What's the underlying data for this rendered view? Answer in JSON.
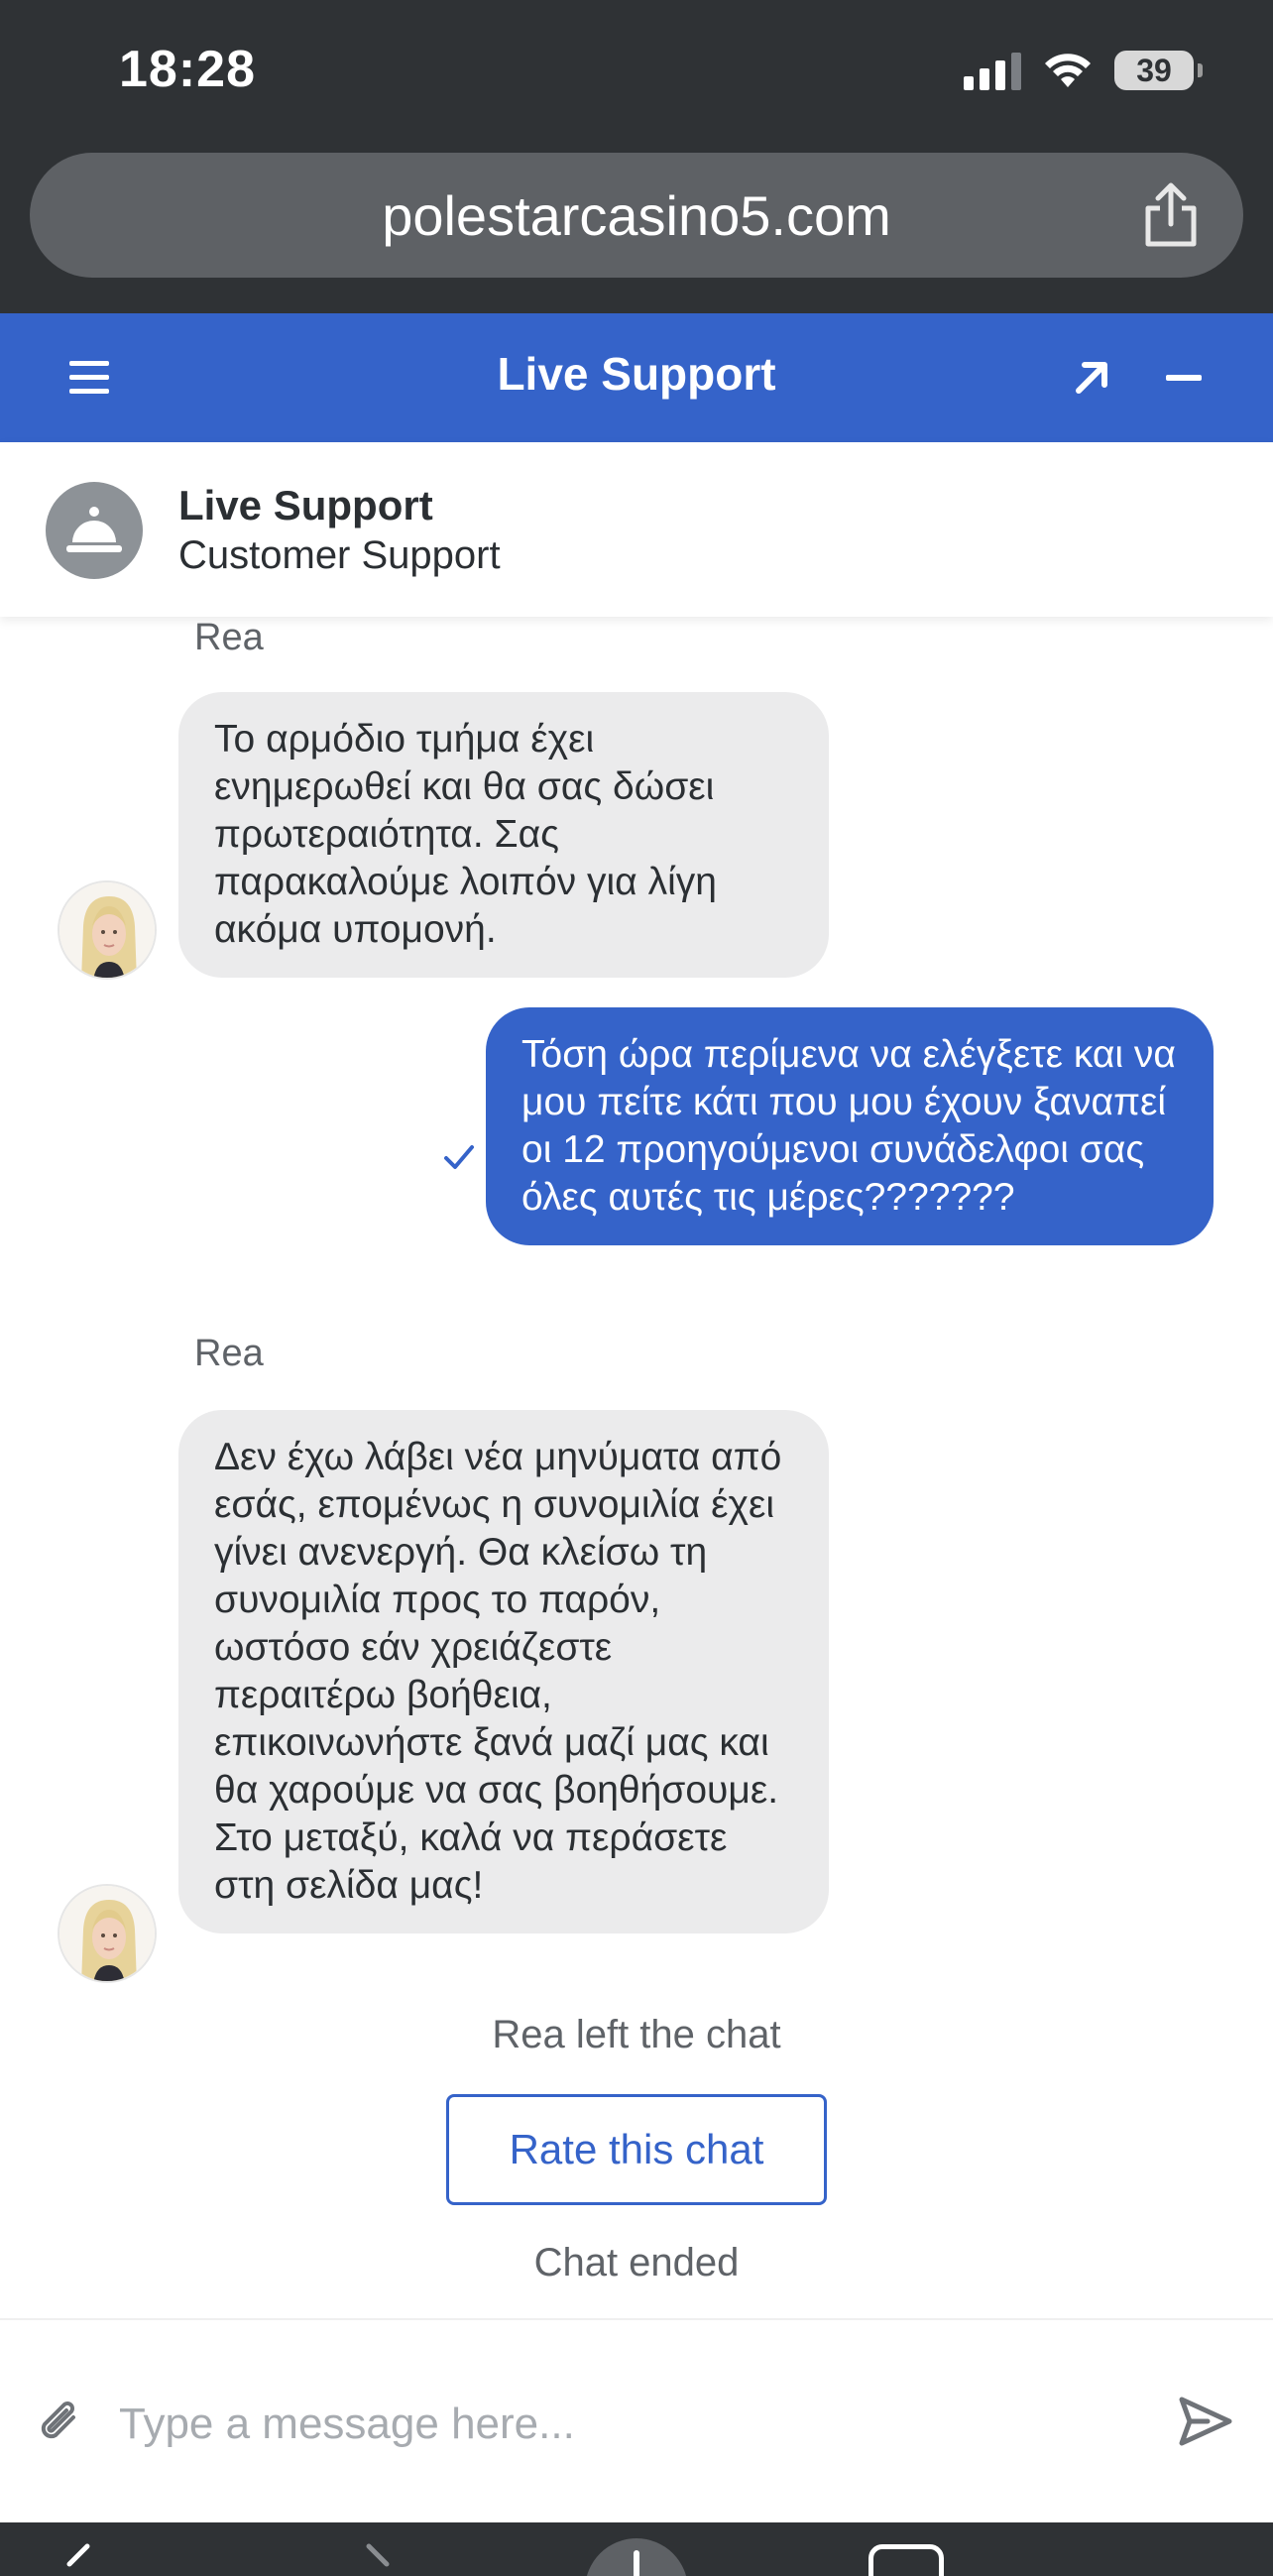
{
  "status_bar": {
    "time": "18:28",
    "battery": "39"
  },
  "browser": {
    "url": "polestarcasino5.com"
  },
  "header": {
    "title": "Live Support"
  },
  "agent": {
    "name": "Live Support",
    "role": "Customer Support"
  },
  "messages": [
    {
      "sender": "Rea",
      "direction": "in",
      "text": "Το αρμόδιο τμήμα έχει ενημερωθεί και θα σας δώσει πρωτεραιότητα. Σας παρακαλούμε λοιπόν για λίγη ακόμα υπομονή."
    },
    {
      "direction": "out",
      "text": "Τόση ώρα περίμενα να ελέγξετε και να μου πείτε κάτι που μου έχουν ξαναπεί οι 12 προηγούμενοι συνάδελφοι σας όλες αυτές τις μέρες???????"
    },
    {
      "sender": "Rea",
      "direction": "in",
      "text": "Δεν έχω λάβει νέα μηνύματα από εσάς, επομένως η συνομιλία έχει γίνει ανενεργή. Θα κλείσω τη συνομιλία προς το παρόν, ωστόσο εάν χρειάζεστε περαιτέρω βοήθεια, επικοινωνήστε ξανά μαζί μας και θα χαρούμε να σας βοηθήσουμε. Στο μεταξύ, καλά να περάσετε στη σελίδα μας!"
    }
  ],
  "system": {
    "left_chat": "Rea left the chat",
    "rate_button": "Rate this chat",
    "chat_ended": "Chat ended"
  },
  "composer": {
    "placeholder": "Type a message here..."
  },
  "colors": {
    "accent": "#3563c9",
    "chrome": "#2f3235",
    "bubble_in": "#ebebec"
  },
  "icons": [
    "menu-icon",
    "expand-icon",
    "minimize-icon",
    "bell-icon",
    "check-icon",
    "attach-icon",
    "send-icon",
    "share-icon"
  ]
}
